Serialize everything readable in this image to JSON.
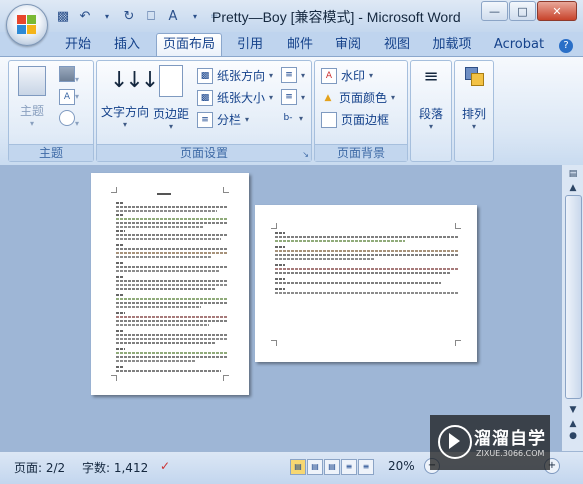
{
  "title": "Pretty—Boy [兼容模式] - Microsoft Word",
  "window_buttons": {
    "minimize": "—",
    "maximize": "□",
    "close": "✕"
  },
  "qat": {
    "more": "="
  },
  "tabs": [
    {
      "label": "开始"
    },
    {
      "label": "插入"
    },
    {
      "label": "页面布局"
    },
    {
      "label": "引用"
    },
    {
      "label": "邮件"
    },
    {
      "label": "审阅"
    },
    {
      "label": "视图"
    },
    {
      "label": "加载项"
    },
    {
      "label": "Acrobat"
    }
  ],
  "ribbon": {
    "theme_group": {
      "label": "主题",
      "theme_button": "主题"
    },
    "page_setup": {
      "label": "页面设置",
      "text_direction": "文字方向",
      "margins": "页边距",
      "orientation": "纸张方向",
      "size": "纸张大小",
      "columns": "分栏"
    },
    "page_background": {
      "label": "页面背景",
      "watermark": "水印",
      "page_color": "页面颜色",
      "page_borders": "页面边框"
    },
    "paragraph": {
      "label": "段落"
    },
    "arrange": {
      "label": "排列"
    }
  },
  "status": {
    "page": "页面: 2/2",
    "words": "字数: 1,412",
    "zoom": "20%"
  },
  "overlay_watermark": {
    "text": "溜溜自学",
    "sub": "ZIXUE.3066.COM"
  }
}
